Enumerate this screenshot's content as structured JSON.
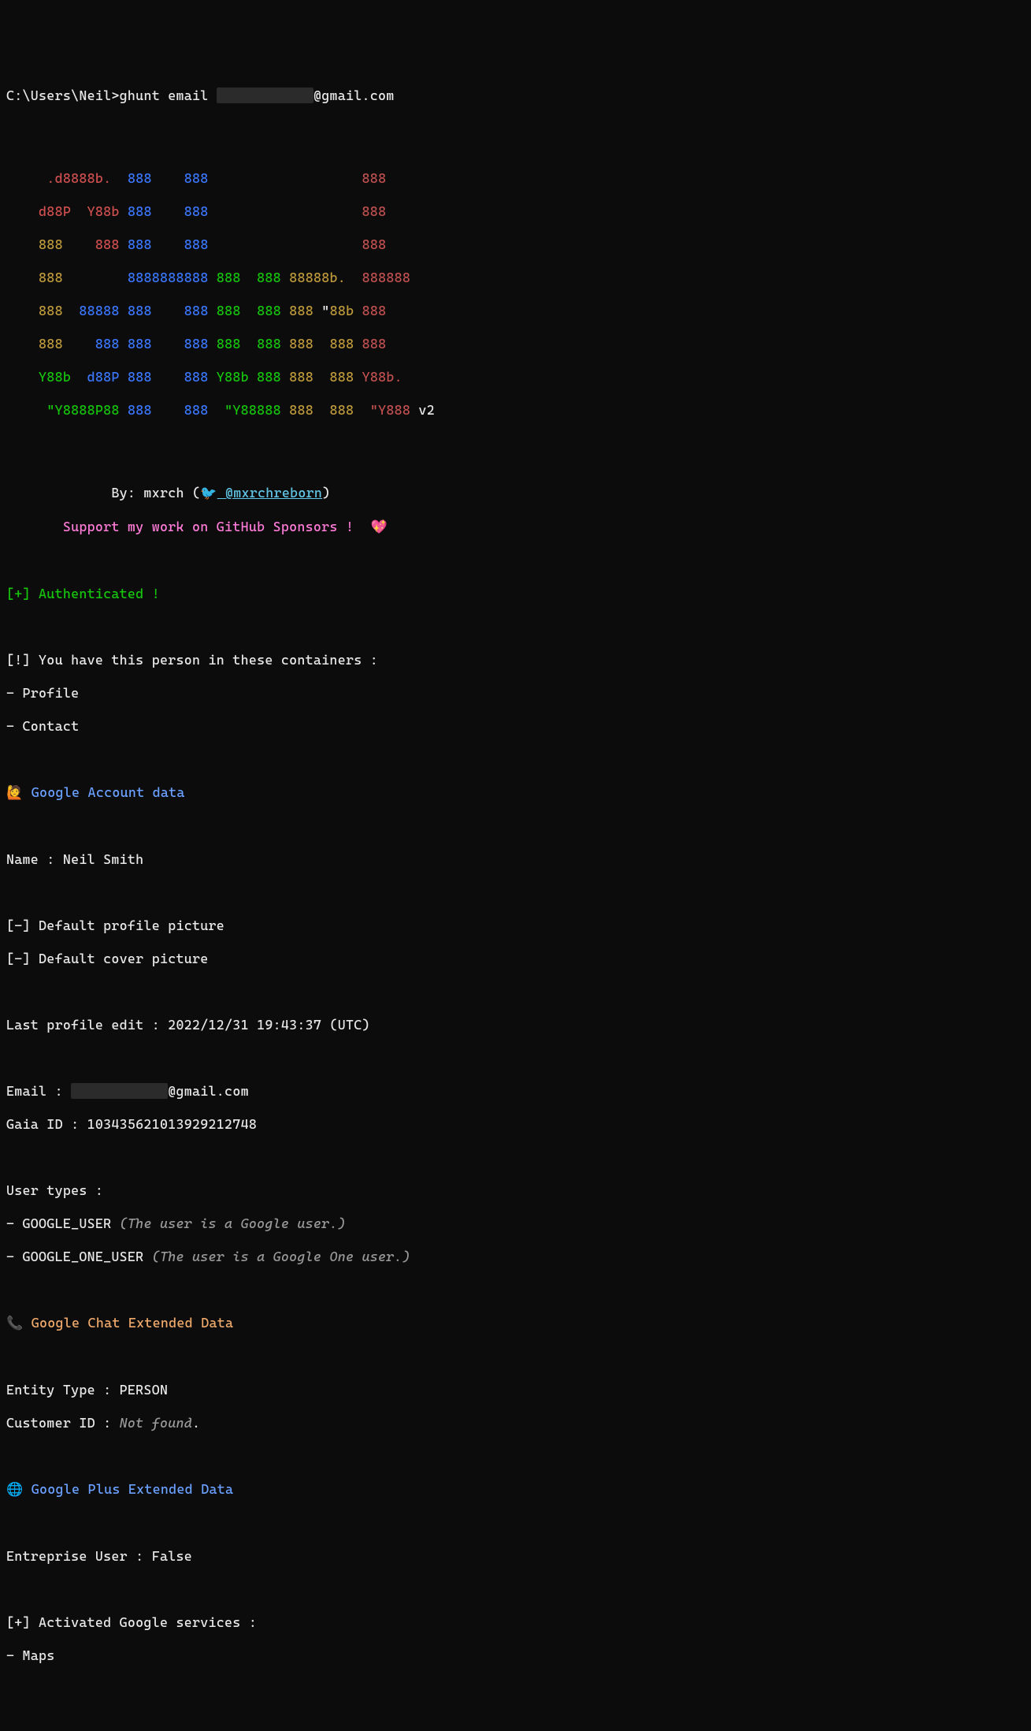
{
  "cmd": {
    "prompt": "C:\\Users\\Neil>",
    "command_pre": "ghunt email ",
    "redacted": "████████████",
    "command_post": "@gmail.com"
  },
  "ascii": {
    "l1": {
      "s1": "     ",
      "s2": ".d8888b.",
      "s3": "  ",
      "s4": "888",
      "s5": "    ",
      "s6": "888",
      "s7": "                   ",
      "s8": "888"
    },
    "l2": {
      "s1": "    ",
      "s2": "d88P",
      "s3": "  ",
      "s4": "Y88b",
      "s5": " ",
      "s6": "888",
      "s7": "    ",
      "s8": "888",
      "s9": "                   ",
      "s10": "888"
    },
    "l3": {
      "s1": "    ",
      "s2": "888",
      "s3": "    ",
      "s4": "888",
      "s5": " ",
      "s6": "888",
      "s7": "    ",
      "s8": "888",
      "s9": "                   ",
      "s10": "888"
    },
    "l4": {
      "s1": "    ",
      "s2": "888",
      "s3": "        ",
      "s4": "8888888888",
      "s5": " ",
      "s6": "888",
      "s7": "  ",
      "s8": "888",
      "s9": " ",
      "s10": "88888b.",
      "s11": "  ",
      "s12": "888888"
    },
    "l5": {
      "s1": "    ",
      "s2": "888",
      "s3": "  ",
      "s4": "88888",
      "s5": " ",
      "s6": "888",
      "s7": "    ",
      "s8": "888",
      "s9": " ",
      "s10": "888",
      "s11": "  ",
      "s12": "888",
      "s13": " ",
      "s14": "888",
      "s15": " \"",
      "s16": "88b",
      "s17": " ",
      "s18": "888"
    },
    "l6": {
      "s1": "    ",
      "s2": "888",
      "s3": "    ",
      "s4": "888",
      "s5": " ",
      "s6": "888",
      "s7": "    ",
      "s8": "888",
      "s9": " ",
      "s10": "888",
      "s11": "  ",
      "s12": "888",
      "s13": " ",
      "s14": "888",
      "s15": "  ",
      "s16": "888",
      "s17": " ",
      "s18": "888"
    },
    "l7": {
      "s1": "    ",
      "s2": "Y88b",
      "s3": "  ",
      "s4": "d88P",
      "s5": " ",
      "s6": "888",
      "s7": "    ",
      "s8": "888",
      "s9": " ",
      "s10": "Y88b",
      "s11": " ",
      "s12": "888",
      "s13": " ",
      "s14": "888",
      "s15": "  ",
      "s16": "888",
      "s17": " ",
      "s18": "Y88b."
    },
    "l8": {
      "s1": "     ",
      "s2": "\"Y8888P88",
      "s3": " ",
      "s4": "888",
      "s5": "    ",
      "s6": "888",
      "s7": "  ",
      "s8": "\"Y88888",
      "s9": " ",
      "s10": "888",
      "s11": "  ",
      "s12": "888",
      "s13": "  ",
      "s14": "\"Y888",
      "s15": " v2"
    }
  },
  "byline": {
    "prefix": "             By: mxrch (",
    "bird": "🐦",
    "handle": " @mxrchreborn",
    "suffix": ")"
  },
  "support": {
    "text": "       Support my work on GitHub Sponsors !",
    "heart": " 💖"
  },
  "auth": "[+] Authenticated !",
  "containers": {
    "header": "[!] You have this person in these containers :",
    "l1": "- Profile",
    "l2": "- Contact"
  },
  "section_account": {
    "emoji": "🙋",
    "title": " Google Account data"
  },
  "name_line": "Name : Neil Smith",
  "profile_pic": "[-] Default profile picture",
  "cover_pic": "[-] Default cover picture",
  "last_edit": "Last profile edit : 2022/12/31 19:43:37 (UTC)",
  "email": {
    "prefix": "Email : ",
    "redacted": "████████████",
    "suffix": "@gmail.com"
  },
  "gaia": "Gaia ID : 103435621013929212748",
  "user_types_header": "User types :",
  "ut1": {
    "code": "- GOOGLE_USER ",
    "desc": "(The user is a Google user.)"
  },
  "ut2": {
    "code": "- GOOGLE_ONE_USER ",
    "desc": "(The user is a Google One user.)"
  },
  "section_chat": {
    "emoji": "📞",
    "title": " Google Chat Extended Data"
  },
  "entity_type": "Entity Type : PERSON",
  "customer_id": {
    "prefix": "Customer ID : ",
    "val": "Not found",
    "dot": "."
  },
  "section_plus": {
    "emoji": "🌐",
    "title": " Google Plus Extended Data"
  },
  "ent_user": "Entreprise User : False",
  "activated_hdr": "[+] Activated Google services :",
  "activated_1": "- Maps"
}
